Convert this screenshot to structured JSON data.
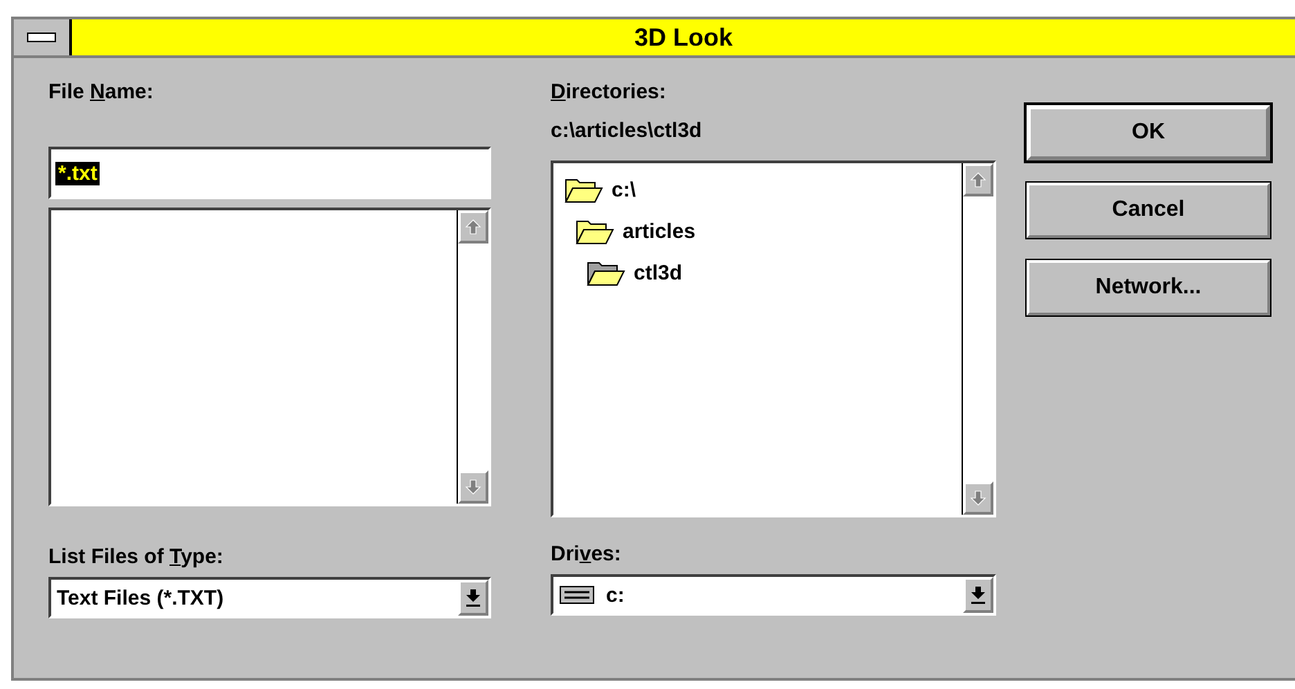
{
  "window": {
    "title": "3D Look"
  },
  "file_name": {
    "label": {
      "before": "File ",
      "key": "N",
      "after": "ame:"
    },
    "value": "*.txt",
    "selected": true
  },
  "file_type": {
    "label": {
      "before": "List Files of ",
      "key": "T",
      "after": "ype:"
    },
    "value": "Text Files (*.TXT)"
  },
  "directories": {
    "label": {
      "key": "D",
      "after": "irectories:"
    },
    "path": "c:\\articles\\ctl3d",
    "tree": [
      {
        "name": "c:\\",
        "current": false,
        "children": [
          {
            "name": "articles",
            "current": false,
            "children": [
              {
                "name": "ctl3d",
                "current": true
              }
            ]
          }
        ]
      }
    ]
  },
  "drives": {
    "label": {
      "before": "Dri",
      "key": "v",
      "after": "es:"
    },
    "value": "c:"
  },
  "buttons": [
    {
      "label": "OK",
      "default": true
    },
    {
      "label": "Cancel",
      "default": false
    },
    {
      "label": "Network...",
      "default": false
    }
  ]
}
